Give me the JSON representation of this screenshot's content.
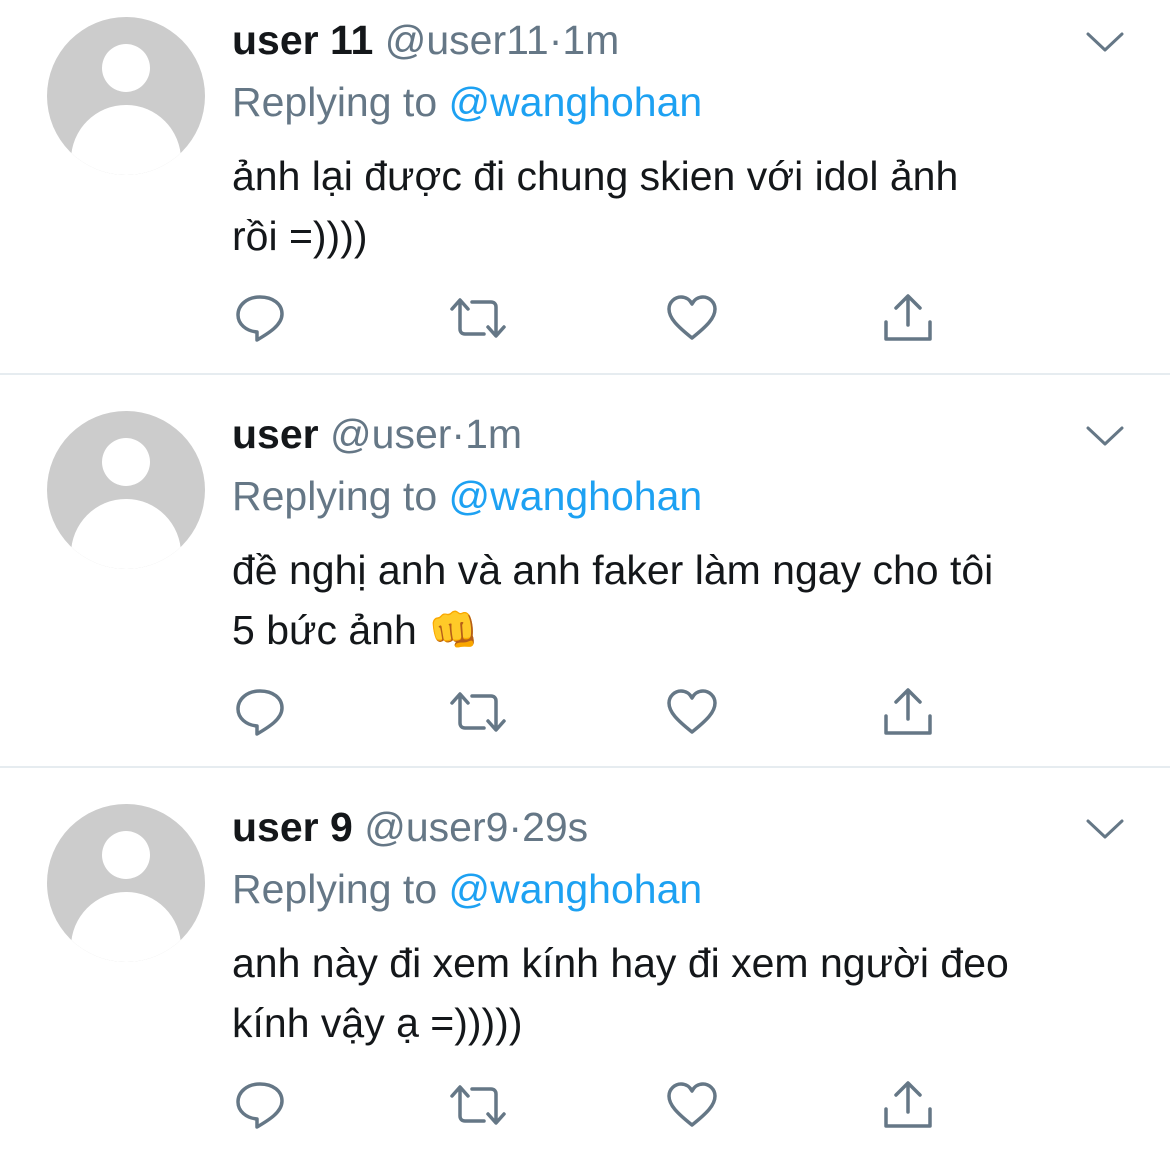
{
  "colors": {
    "text": "#14171a",
    "secondary": "#657786",
    "link": "#1da1f2",
    "divider": "#e6ecf0",
    "avatar_bg": "#cccccc"
  },
  "reply_prefix": "Replying to",
  "separator": "·",
  "icons": {
    "reply": "reply-icon",
    "retweet": "retweet-icon",
    "like": "heart-icon",
    "share": "share-icon",
    "more": "chevron-down-icon",
    "avatar": "default-avatar-icon"
  },
  "tweets": [
    {
      "display_name": "user 11",
      "handle": "@user11",
      "time": "1m",
      "replying_to": "@wanghohan",
      "text": "ảnh lại được đi chung skien với idol ảnh\nrồi =))))"
    },
    {
      "display_name": "user",
      "handle": "@user",
      "time": "1m",
      "replying_to": "@wanghohan",
      "text": "đề nghị anh và anh faker làm ngay cho tôi\n5 bức ảnh 👊"
    },
    {
      "display_name": "user 9",
      "handle": "@user9",
      "time": "29s",
      "replying_to": "@wanghohan",
      "text": "anh này đi xem kính hay đi xem người đeo\nkính vậy ạ =)))))"
    }
  ]
}
